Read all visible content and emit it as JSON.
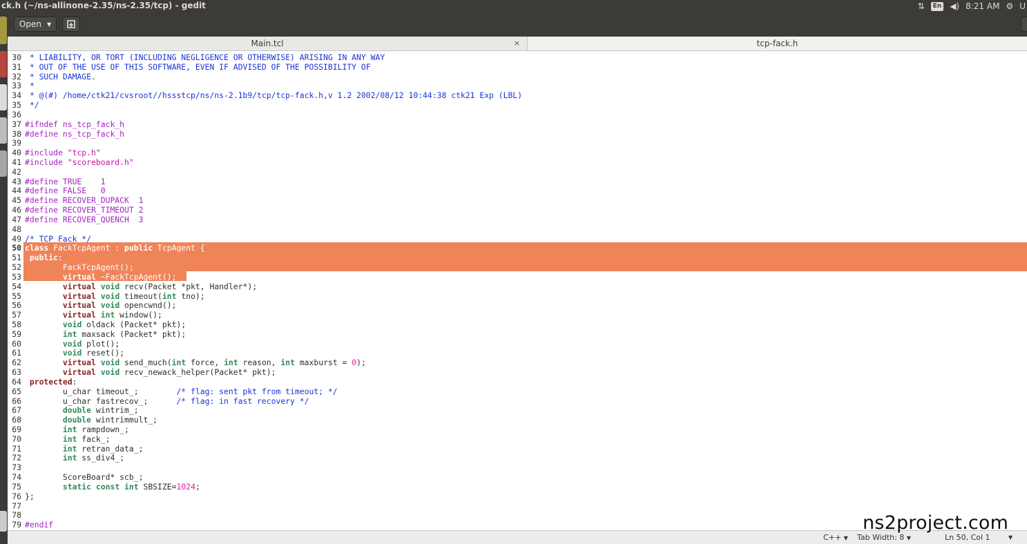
{
  "window": {
    "title": "ck.h (~/ns-allinone-2.35/ns-2.35/tcp) - gedit"
  },
  "tray": {
    "keyboard": "En",
    "time": "8:21 AM",
    "user_initial": "U"
  },
  "toolbar": {
    "open_label": "Open"
  },
  "tabs": [
    {
      "label": "Main.tcl",
      "active": false
    },
    {
      "label": "tcp-fack.h",
      "active": true
    }
  ],
  "editor": {
    "current_line": 50,
    "selection_lines": [
      50,
      53
    ],
    "selection_color": "#ef8459",
    "lines": [
      {
        "n": 30,
        "tokens": [
          {
            "t": " * LIABILITY, OR TORT (INCLUDING NEGLIGENCE OR OTHERWISE) ARISING IN ANY WAY",
            "c": "c"
          }
        ]
      },
      {
        "n": 31,
        "tokens": [
          {
            "t": " * OUT OF THE USE OF THIS SOFTWARE, EVEN IF ADVISED OF THE POSSIBILITY OF",
            "c": "c"
          }
        ]
      },
      {
        "n": 32,
        "tokens": [
          {
            "t": " * SUCH DAMAGE.",
            "c": "c"
          }
        ]
      },
      {
        "n": 33,
        "tokens": [
          {
            "t": " *",
            "c": "c"
          }
        ]
      },
      {
        "n": 34,
        "tokens": [
          {
            "t": " * @(#) /home/ctk21/cvsroot//hssstcp/ns/ns-2.1b9/tcp/tcp-fack.h,v 1.2 2002/08/12 10:44:38 ctk21 Exp (LBL)",
            "c": "c"
          }
        ]
      },
      {
        "n": 35,
        "tokens": [
          {
            "t": " */",
            "c": "c"
          }
        ]
      },
      {
        "n": 36,
        "tokens": []
      },
      {
        "n": 37,
        "tokens": [
          {
            "t": "#ifndef ns_tcp_fack_h",
            "c": "p"
          }
        ]
      },
      {
        "n": 38,
        "tokens": [
          {
            "t": "#define ns_tcp_fack_h",
            "c": "p"
          }
        ]
      },
      {
        "n": 39,
        "tokens": []
      },
      {
        "n": 40,
        "tokens": [
          {
            "t": "#include ",
            "c": "p"
          },
          {
            "t": "\"tcp.h\"",
            "c": "s"
          }
        ]
      },
      {
        "n": 41,
        "tokens": [
          {
            "t": "#include ",
            "c": "p"
          },
          {
            "t": "\"scoreboard.h\"",
            "c": "s"
          }
        ]
      },
      {
        "n": 42,
        "tokens": []
      },
      {
        "n": 43,
        "tokens": [
          {
            "t": "#define TRUE    1",
            "c": "p"
          }
        ]
      },
      {
        "n": 44,
        "tokens": [
          {
            "t": "#define FALSE   0",
            "c": "p"
          }
        ]
      },
      {
        "n": 45,
        "tokens": [
          {
            "t": "#define RECOVER_DUPACK  1",
            "c": "p"
          }
        ]
      },
      {
        "n": 46,
        "tokens": [
          {
            "t": "#define RECOVER_TIMEOUT 2",
            "c": "p"
          }
        ]
      },
      {
        "n": 47,
        "tokens": [
          {
            "t": "#define RECOVER_QUENCH  3",
            "c": "p"
          }
        ]
      },
      {
        "n": 48,
        "tokens": []
      },
      {
        "n": 49,
        "tokens": [
          {
            "t": "/* TCP Fack */",
            "c": "c"
          }
        ]
      },
      {
        "n": 50,
        "tokens": [
          {
            "t": "class",
            "c": "k"
          },
          {
            "t": " FackTcpAgent : ",
            "c": ""
          },
          {
            "t": "public",
            "c": "k"
          },
          {
            "t": " TcpAgent {",
            "c": ""
          }
        ]
      },
      {
        "n": 51,
        "tokens": [
          {
            "t": " ",
            "c": ""
          },
          {
            "t": "public",
            "c": "k"
          },
          {
            "t": ":",
            "c": ""
          }
        ]
      },
      {
        "n": 52,
        "tokens": [
          {
            "t": "        FackTcpAgent();",
            "c": ""
          }
        ]
      },
      {
        "n": 53,
        "tokens": [
          {
            "t": "        ",
            "c": ""
          },
          {
            "t": "virtual",
            "c": "k"
          },
          {
            "t": " ~FackTcpAgent();",
            "c": ""
          }
        ]
      },
      {
        "n": 54,
        "tokens": [
          {
            "t": "        ",
            "c": ""
          },
          {
            "t": "virtual",
            "c": "k"
          },
          {
            "t": " ",
            "c": ""
          },
          {
            "t": "void",
            "c": "y"
          },
          {
            "t": " recv(Packet *pkt, Handler*);",
            "c": ""
          }
        ]
      },
      {
        "n": 55,
        "tokens": [
          {
            "t": "        ",
            "c": ""
          },
          {
            "t": "virtual",
            "c": "k"
          },
          {
            "t": " ",
            "c": ""
          },
          {
            "t": "void",
            "c": "y"
          },
          {
            "t": " timeout(",
            "c": ""
          },
          {
            "t": "int",
            "c": "y"
          },
          {
            "t": " tno);",
            "c": ""
          }
        ]
      },
      {
        "n": 56,
        "tokens": [
          {
            "t": "        ",
            "c": ""
          },
          {
            "t": "virtual",
            "c": "k"
          },
          {
            "t": " ",
            "c": ""
          },
          {
            "t": "void",
            "c": "y"
          },
          {
            "t": " opencwnd();",
            "c": ""
          }
        ]
      },
      {
        "n": 57,
        "tokens": [
          {
            "t": "        ",
            "c": ""
          },
          {
            "t": "virtual",
            "c": "k"
          },
          {
            "t": " ",
            "c": ""
          },
          {
            "t": "int",
            "c": "y"
          },
          {
            "t": " window();",
            "c": ""
          }
        ]
      },
      {
        "n": 58,
        "tokens": [
          {
            "t": "        ",
            "c": ""
          },
          {
            "t": "void",
            "c": "y"
          },
          {
            "t": " oldack (Packet* pkt);",
            "c": ""
          }
        ]
      },
      {
        "n": 59,
        "tokens": [
          {
            "t": "        ",
            "c": ""
          },
          {
            "t": "int",
            "c": "y"
          },
          {
            "t": " maxsack (Packet* pkt);",
            "c": ""
          }
        ]
      },
      {
        "n": 60,
        "tokens": [
          {
            "t": "        ",
            "c": ""
          },
          {
            "t": "void",
            "c": "y"
          },
          {
            "t": " plot();",
            "c": ""
          }
        ]
      },
      {
        "n": 61,
        "tokens": [
          {
            "t": "        ",
            "c": ""
          },
          {
            "t": "void",
            "c": "y"
          },
          {
            "t": " reset();",
            "c": ""
          }
        ]
      },
      {
        "n": 62,
        "tokens": [
          {
            "t": "        ",
            "c": ""
          },
          {
            "t": "virtual",
            "c": "k"
          },
          {
            "t": " ",
            "c": ""
          },
          {
            "t": "void",
            "c": "y"
          },
          {
            "t": " send_much(",
            "c": ""
          },
          {
            "t": "int",
            "c": "y"
          },
          {
            "t": " force, ",
            "c": ""
          },
          {
            "t": "int",
            "c": "y"
          },
          {
            "t": " reason, ",
            "c": ""
          },
          {
            "t": "int",
            "c": "y"
          },
          {
            "t": " maxburst = ",
            "c": ""
          },
          {
            "t": "0",
            "c": "n"
          },
          {
            "t": ");",
            "c": ""
          }
        ]
      },
      {
        "n": 63,
        "tokens": [
          {
            "t": "        ",
            "c": ""
          },
          {
            "t": "virtual",
            "c": "k"
          },
          {
            "t": " ",
            "c": ""
          },
          {
            "t": "void",
            "c": "y"
          },
          {
            "t": " recv_newack_helper(Packet* pkt);",
            "c": ""
          }
        ]
      },
      {
        "n": 64,
        "tokens": [
          {
            "t": " ",
            "c": ""
          },
          {
            "t": "protected",
            "c": "k"
          },
          {
            "t": ":",
            "c": ""
          }
        ]
      },
      {
        "n": 65,
        "tokens": [
          {
            "t": "        u_char timeout_;        ",
            "c": ""
          },
          {
            "t": "/* flag: sent pkt from timeout; */",
            "c": "c"
          }
        ]
      },
      {
        "n": 66,
        "tokens": [
          {
            "t": "        u_char fastrecov_;      ",
            "c": ""
          },
          {
            "t": "/* flag: in fast recovery */",
            "c": "c"
          }
        ]
      },
      {
        "n": 67,
        "tokens": [
          {
            "t": "        ",
            "c": ""
          },
          {
            "t": "double",
            "c": "y"
          },
          {
            "t": " wintrim_;",
            "c": ""
          }
        ]
      },
      {
        "n": 68,
        "tokens": [
          {
            "t": "        ",
            "c": ""
          },
          {
            "t": "double",
            "c": "y"
          },
          {
            "t": " wintrimmult_;",
            "c": ""
          }
        ]
      },
      {
        "n": 69,
        "tokens": [
          {
            "t": "        ",
            "c": ""
          },
          {
            "t": "int",
            "c": "y"
          },
          {
            "t": " rampdown_;",
            "c": ""
          }
        ]
      },
      {
        "n": 70,
        "tokens": [
          {
            "t": "        ",
            "c": ""
          },
          {
            "t": "int",
            "c": "y"
          },
          {
            "t": " fack_;",
            "c": ""
          }
        ]
      },
      {
        "n": 71,
        "tokens": [
          {
            "t": "        ",
            "c": ""
          },
          {
            "t": "int",
            "c": "y"
          },
          {
            "t": " retran_data_;",
            "c": ""
          }
        ]
      },
      {
        "n": 72,
        "tokens": [
          {
            "t": "        ",
            "c": ""
          },
          {
            "t": "int",
            "c": "y"
          },
          {
            "t": " ss_div4_;",
            "c": ""
          }
        ]
      },
      {
        "n": 73,
        "tokens": []
      },
      {
        "n": 74,
        "tokens": [
          {
            "t": "        ScoreBoard* scb_;",
            "c": ""
          }
        ]
      },
      {
        "n": 75,
        "tokens": [
          {
            "t": "        ",
            "c": ""
          },
          {
            "t": "static",
            "c": "y"
          },
          {
            "t": " ",
            "c": ""
          },
          {
            "t": "const",
            "c": "y"
          },
          {
            "t": " ",
            "c": ""
          },
          {
            "t": "int",
            "c": "y"
          },
          {
            "t": " SBSIZE=",
            "c": ""
          },
          {
            "t": "1024",
            "c": "n"
          },
          {
            "t": ";",
            "c": ""
          }
        ]
      },
      {
        "n": 76,
        "tokens": [
          {
            "t": "};",
            "c": ""
          }
        ]
      },
      {
        "n": 77,
        "tokens": []
      },
      {
        "n": 78,
        "tokens": []
      },
      {
        "n": 79,
        "tokens": [
          {
            "t": "#endif",
            "c": "p"
          }
        ]
      }
    ]
  },
  "statusbar": {
    "language": "C++",
    "tab_width": "Tab Width: 8",
    "position": "Ln 50, Col 1"
  },
  "watermark": "ns2project.com",
  "colors": {
    "comment": "#1a34d6",
    "preprocessor": "#a223c2",
    "string": "#c2129f",
    "number": "#e01ba0",
    "keyword": "#8b1e1e",
    "type": "#2e8b57"
  }
}
